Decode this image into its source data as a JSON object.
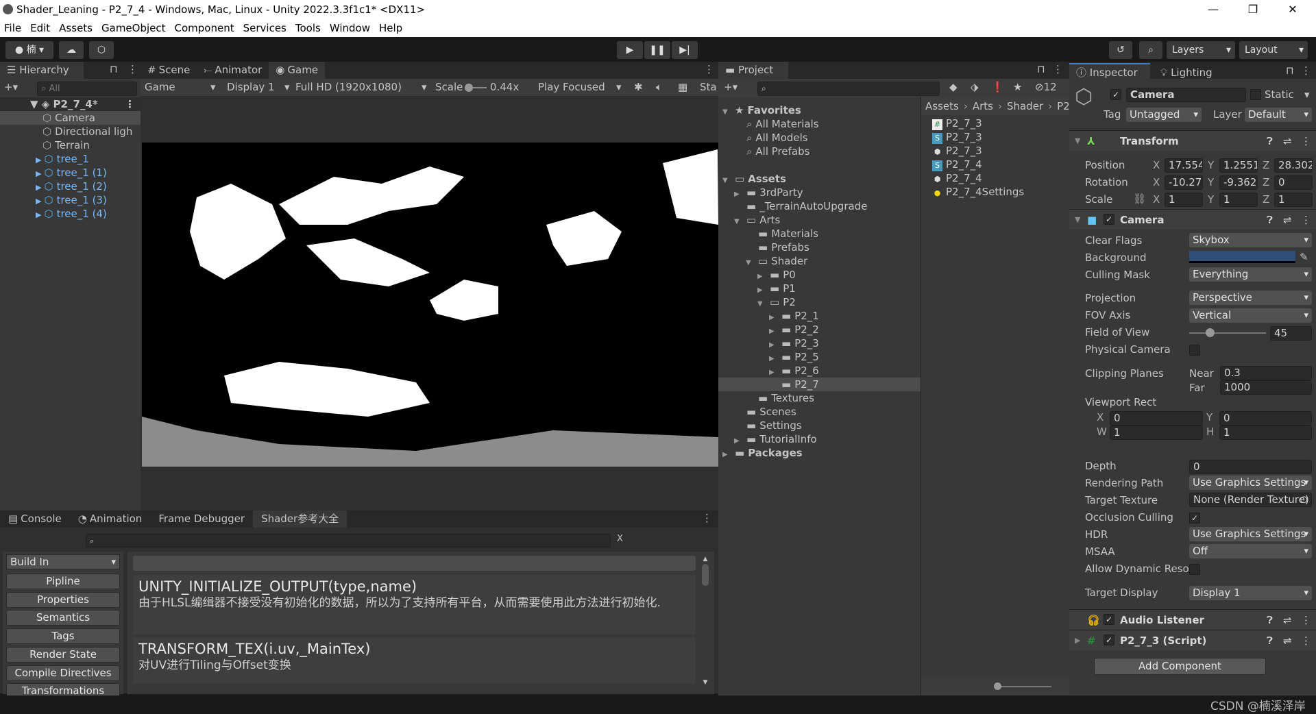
{
  "window": {
    "title": "Shader_Leaning - P2_7_4 - Windows, Mac, Linux - Unity 2022.3.3f1c1* <DX11>",
    "minimize": "—",
    "maximize": "❐",
    "close": "✕"
  },
  "menu": [
    "File",
    "Edit",
    "Assets",
    "GameObject",
    "Component",
    "Services",
    "Tools",
    "Window",
    "Help"
  ],
  "toolbar": {
    "account": "楠",
    "layers": "Layers",
    "layout": "Layout"
  },
  "hierarchy": {
    "tab": "Hierarchy",
    "search_placeholder": "All",
    "scene": "P2_7_4*",
    "items": [
      {
        "label": "Camera",
        "type": "go",
        "selected": true
      },
      {
        "label": "Directional ligh",
        "type": "go"
      },
      {
        "label": "Terrain",
        "type": "go"
      },
      {
        "label": "tree_1",
        "type": "prefab"
      },
      {
        "label": "tree_1 (1)",
        "type": "prefab"
      },
      {
        "label": "tree_1 (2)",
        "type": "prefab"
      },
      {
        "label": "tree_1 (3)",
        "type": "prefab"
      },
      {
        "label": "tree_1 (4)",
        "type": "prefab"
      }
    ]
  },
  "game": {
    "tabs": [
      "Scene",
      "Animator",
      "Game"
    ],
    "active_tab": "Game",
    "mode": "Game",
    "display": "Display 1",
    "resolution": "Full HD (1920x1080)",
    "scale_label": "Scale",
    "scale_value": "0.44x",
    "play_mode": "Play Focused",
    "stats": "Sta"
  },
  "bottom": {
    "tabs": [
      "Console",
      "Animation",
      "Frame Debugger",
      "Shader参考大全"
    ],
    "active_tab": "Shader参考大全",
    "clear": "X",
    "dropdown": "Build In",
    "categories": [
      "Pipline",
      "Properties",
      "Semantics",
      "Tags",
      "Render State",
      "Compile Directives",
      "Transformations"
    ],
    "entries": [
      {
        "title": "UNITY_INITIALIZE_OUTPUT(type,name)",
        "desc": "由于HLSL编缉器不接受没有初始化的数据，所以为了支持所有平台，从而需要使用此方法进行初始化."
      },
      {
        "title": "TRANSFORM_TEX(i.uv,_MainTex)",
        "desc": "对UV进行Tiling与Offset变换"
      }
    ]
  },
  "project": {
    "tab": "Project",
    "hidden_count": "12",
    "tree": [
      {
        "label": "Favorites",
        "depth": 0,
        "arrow": "▼",
        "icon": "star",
        "bold": true
      },
      {
        "label": "All Materials",
        "depth": 1,
        "icon": "search"
      },
      {
        "label": "All Models",
        "depth": 1,
        "icon": "search"
      },
      {
        "label": "All Prefabs",
        "depth": 1,
        "icon": "search"
      },
      {
        "label": "",
        "depth": 0
      },
      {
        "label": "Assets",
        "depth": 0,
        "arrow": "▼",
        "icon": "folder-open",
        "bold": true
      },
      {
        "label": "3rdParty",
        "depth": 1,
        "arrow": "▶",
        "icon": "folder"
      },
      {
        "label": "_TerrainAutoUpgrade",
        "depth": 1,
        "icon": "folder"
      },
      {
        "label": "Arts",
        "depth": 1,
        "arrow": "▼",
        "icon": "folder-open"
      },
      {
        "label": "Materials",
        "depth": 2,
        "icon": "folder"
      },
      {
        "label": "Prefabs",
        "depth": 2,
        "icon": "folder"
      },
      {
        "label": "Shader",
        "depth": 2,
        "arrow": "▼",
        "icon": "folder-open"
      },
      {
        "label": "P0",
        "depth": 3,
        "arrow": "▶",
        "icon": "folder"
      },
      {
        "label": "P1",
        "depth": 3,
        "arrow": "▶",
        "icon": "folder"
      },
      {
        "label": "P2",
        "depth": 3,
        "arrow": "▼",
        "icon": "folder-open"
      },
      {
        "label": "P2_1",
        "depth": 4,
        "arrow": "▶",
        "icon": "folder"
      },
      {
        "label": "P2_2",
        "depth": 4,
        "arrow": "▶",
        "icon": "folder"
      },
      {
        "label": "P2_3",
        "depth": 4,
        "arrow": "▶",
        "icon": "folder"
      },
      {
        "label": "P2_5",
        "depth": 4,
        "arrow": "▶",
        "icon": "folder"
      },
      {
        "label": "P2_6",
        "depth": 4,
        "arrow": "▶",
        "icon": "folder"
      },
      {
        "label": "P2_7",
        "depth": 4,
        "icon": "folder",
        "selected": true
      },
      {
        "label": "Textures",
        "depth": 2,
        "icon": "folder"
      },
      {
        "label": "Scenes",
        "depth": 1,
        "icon": "folder"
      },
      {
        "label": "Settings",
        "depth": 1,
        "icon": "folder"
      },
      {
        "label": "TutorialInfo",
        "depth": 1,
        "arrow": "▶",
        "icon": "folder"
      },
      {
        "label": "Packages",
        "depth": 0,
        "arrow": "▶",
        "icon": "folder",
        "bold": true
      }
    ],
    "breadcrumb": [
      "Assets",
      "Arts",
      "Shader",
      "P2"
    ],
    "files": [
      {
        "label": "P2_7_3",
        "icon": "csharp"
      },
      {
        "label": "P2_7_3",
        "icon": "shader"
      },
      {
        "label": "P2_7_3",
        "icon": "unity-scene"
      },
      {
        "label": "P2_7_4",
        "icon": "shader"
      },
      {
        "label": "P2_7_4",
        "icon": "unity-scene"
      },
      {
        "label": "P2_7_4Settings",
        "icon": "lighting-settings"
      }
    ]
  },
  "inspector": {
    "tabs": [
      "Inspector",
      "Lighting"
    ],
    "name": "Camera",
    "static": "Static",
    "tag_label": "Tag",
    "tag": "Untagged",
    "layer_label": "Layer",
    "layer": "Default",
    "transform": {
      "title": "Transform",
      "position_label": "Position",
      "rotation_label": "Rotation",
      "scale_label": "Scale",
      "position": [
        "17.554",
        "1.2551",
        "28.302"
      ],
      "rotation": [
        "-10.27",
        "-9.362",
        "0"
      ],
      "scale": [
        "1",
        "1",
        "1"
      ],
      "axes": [
        "X",
        "Y",
        "Z"
      ]
    },
    "camera": {
      "title": "Camera",
      "clear_flags_label": "Clear Flags",
      "clear_flags": "Skybox",
      "background_label": "Background",
      "background_color": "#314d79",
      "culling_mask_label": "Culling Mask",
      "culling_mask": "Everything",
      "projection_label": "Projection",
      "projection": "Perspective",
      "fov_axis_label": "FOV Axis",
      "fov_axis": "Vertical",
      "fov_label": "Field of View",
      "fov": "45",
      "physical_label": "Physical Camera",
      "clipping_label": "Clipping Planes",
      "near_label": "Near",
      "near": "0.3",
      "far_label": "Far",
      "far": "1000",
      "viewport_label": "Viewport Rect",
      "vx_label": "X",
      "vx": "0",
      "vy_label": "Y",
      "vy": "0",
      "vw_label": "W",
      "vw": "1",
      "vh_label": "H",
      "vh": "1",
      "depth_label": "Depth",
      "depth": "0",
      "rendering_path_label": "Rendering Path",
      "rendering_path": "Use Graphics Settings",
      "target_texture_label": "Target Texture",
      "target_texture": "None (Render Texture)",
      "occlusion_label": "Occlusion Culling",
      "hdr_label": "HDR",
      "hdr": "Use Graphics Settings",
      "msaa_label": "MSAA",
      "msaa": "Off",
      "dynres_label": "Allow Dynamic Reso",
      "target_display_label": "Target Display",
      "target_display": "Display 1"
    },
    "audio_listener": "Audio Listener",
    "script": "P2_7_3 (Script)",
    "add_component": "Add Component"
  },
  "status": {
    "watermark": "CSDN @楠溪泽岸"
  }
}
